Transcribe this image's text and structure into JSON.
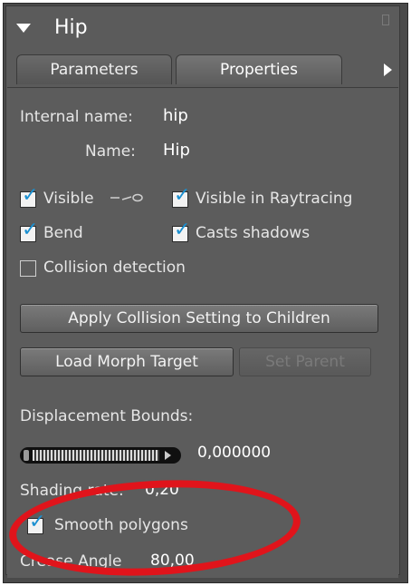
{
  "header": {
    "title": "Hip"
  },
  "tabs": [
    {
      "label": "Parameters",
      "active": false
    },
    {
      "label": "Properties",
      "active": true
    }
  ],
  "properties": {
    "internal_name_label": "Internal name:",
    "internal_name_value": "hip",
    "name_label": "Name:",
    "name_value": "Hip"
  },
  "checkboxes": {
    "visible": {
      "label": "Visible",
      "checked": true
    },
    "visible_in_raytracing": {
      "label": "Visible in Raytracing",
      "checked": true
    },
    "bend": {
      "label": "Bend",
      "checked": true
    },
    "casts_shadows": {
      "label": "Casts shadows",
      "checked": true
    },
    "collision_detection": {
      "label": "Collision detection",
      "checked": false
    },
    "smooth_polygons": {
      "label": "Smooth polygons",
      "checked": true
    }
  },
  "buttons": {
    "apply_collision": "Apply Collision Setting to Children",
    "load_morph": "Load Morph Target",
    "set_parent": "Set Parent"
  },
  "displacement": {
    "label": "Displacement Bounds:",
    "value": "0,000000"
  },
  "shading": {
    "label": "Shading rate:",
    "value": "0,20"
  },
  "crease": {
    "label": "Crease Angle",
    "value": "80,00"
  },
  "colors": {
    "panel_bg": "#5c5c5c",
    "check_blue": "#1a8fd0",
    "highlight_red": "#e0141b"
  }
}
